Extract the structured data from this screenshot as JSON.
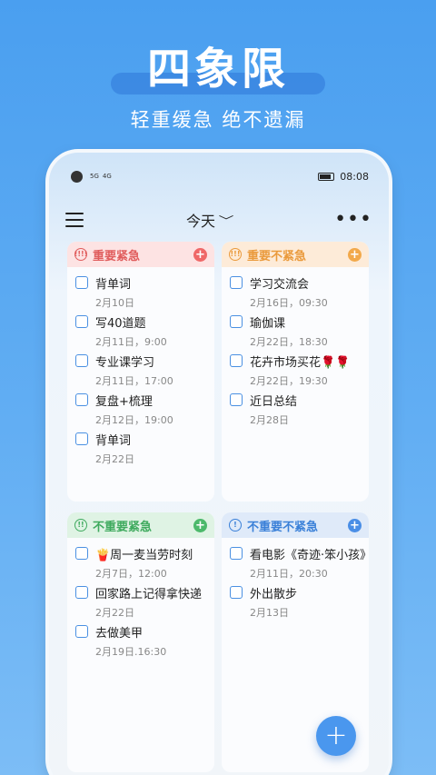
{
  "promo": {
    "headline": "四象限",
    "subline": "轻重缓急 绝不遗漏"
  },
  "status_bar": {
    "signal_left": "5G",
    "signal_right": "4G",
    "time": "08:08"
  },
  "appbar": {
    "title": "今天",
    "menu_icon": "hamburger-icon",
    "more_icon": "more-icon"
  },
  "quadrants": [
    {
      "title": "重要紧急",
      "color": "#e05c5c",
      "icon": "!!!!",
      "tasks": [
        {
          "name": "背单词",
          "date": "2月10日"
        },
        {
          "name": "写40道题",
          "date": "2月11日，9:00"
        },
        {
          "name": "专业课学习",
          "date": "2月11日，17:00"
        },
        {
          "name": "复盘+梳理",
          "date": "2月12日，19:00"
        },
        {
          "name": "背单词",
          "date": "2月22日"
        }
      ]
    },
    {
      "title": "重要不紧急",
      "color": "#ea9a3c",
      "icon": "!!!",
      "tasks": [
        {
          "name": "学习交流会",
          "date": "2月16日，09:30"
        },
        {
          "name": "瑜伽课",
          "date": "2月22日，18:30"
        },
        {
          "name": "花卉市场买花🌹🌹",
          "date": "2月22日，19:30"
        },
        {
          "name": "近日总结",
          "date": "2月28日"
        }
      ]
    },
    {
      "title": "不重要紧急",
      "color": "#3faa5e",
      "icon": "!!",
      "tasks": [
        {
          "name": "🍟周一麦当劳时刻",
          "date": "2月7日，12:00"
        },
        {
          "name": "回家路上记得拿快递",
          "date": "2月22日"
        },
        {
          "name": "去做美甲",
          "date": "2月19日.16:30"
        }
      ]
    },
    {
      "title": "不重要不紧急",
      "color": "#3a80d8",
      "icon": "!",
      "tasks": [
        {
          "name": "看电影《奇迹·笨小孩》",
          "date": "2月11日，20:30"
        },
        {
          "name": "外出散步",
          "date": "2月13日"
        }
      ]
    }
  ],
  "fab": {
    "label": "+"
  }
}
